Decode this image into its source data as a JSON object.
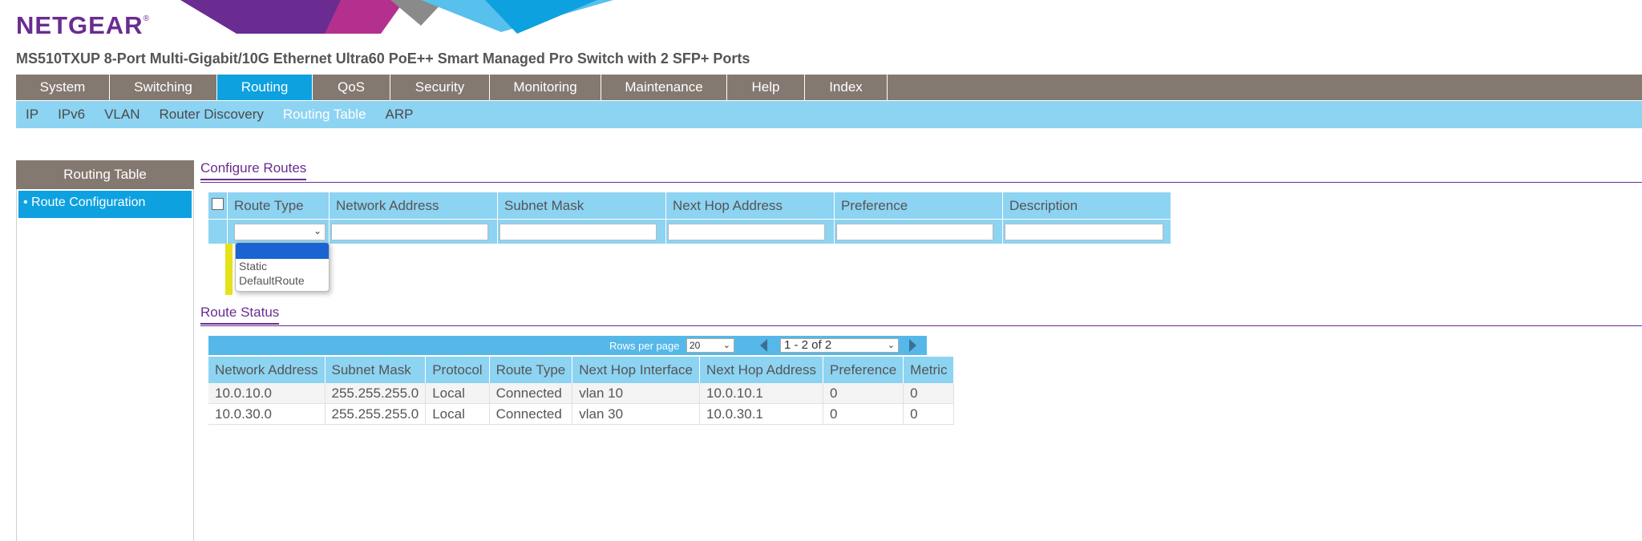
{
  "brand": {
    "logo_text": "NETGEAR",
    "logo_mark": "®"
  },
  "product_title": "MS510TXUP 8-Port Multi-Gigabit/10G Ethernet Ultra60 PoE++ Smart Managed Pro Switch with 2 SFP+ Ports",
  "main_nav": [
    {
      "label": "System"
    },
    {
      "label": "Switching"
    },
    {
      "label": "Routing"
    },
    {
      "label": "QoS"
    },
    {
      "label": "Security"
    },
    {
      "label": "Monitoring"
    },
    {
      "label": "Maintenance"
    },
    {
      "label": "Help"
    },
    {
      "label": "Index"
    }
  ],
  "sub_nav": [
    {
      "label": "IP"
    },
    {
      "label": "IPv6"
    },
    {
      "label": "VLAN"
    },
    {
      "label": "Router Discovery"
    },
    {
      "label": "Routing Table"
    },
    {
      "label": "ARP"
    }
  ],
  "left_panel": {
    "header": "Routing Table",
    "item": "• Route Configuration"
  },
  "configure": {
    "title": "Configure Routes",
    "columns": [
      "Route Type",
      "Network Address",
      "Subnet Mask",
      "Next Hop Address",
      "Preference",
      "Description"
    ],
    "route_type_options": [
      "",
      "Static",
      "DefaultRoute"
    ]
  },
  "status": {
    "title": "Route Status",
    "rows_per_page_label": "Rows per page",
    "rows_per_page_value": "20",
    "page_value": "1 - 2 of 2",
    "columns": [
      "Network Address",
      "Subnet Mask",
      "Protocol",
      "Route Type",
      "Next Hop Interface",
      "Next Hop Address",
      "Preference",
      "Metric"
    ],
    "rows": [
      [
        "10.0.10.0",
        "255.255.255.0",
        "Local",
        "Connected",
        "vlan 10",
        "10.0.10.1",
        "0",
        "0"
      ],
      [
        "10.0.30.0",
        "255.255.255.0",
        "Local",
        "Connected",
        "vlan 30",
        "10.0.30.1",
        "0",
        "0"
      ]
    ]
  },
  "colors": {
    "brand_purple": "#6a2c91",
    "nav_gray": "#847971",
    "active_blue": "#0da1e0",
    "light_blue": "#8dd3f2",
    "highlight_yellow": "#e6e21a"
  }
}
